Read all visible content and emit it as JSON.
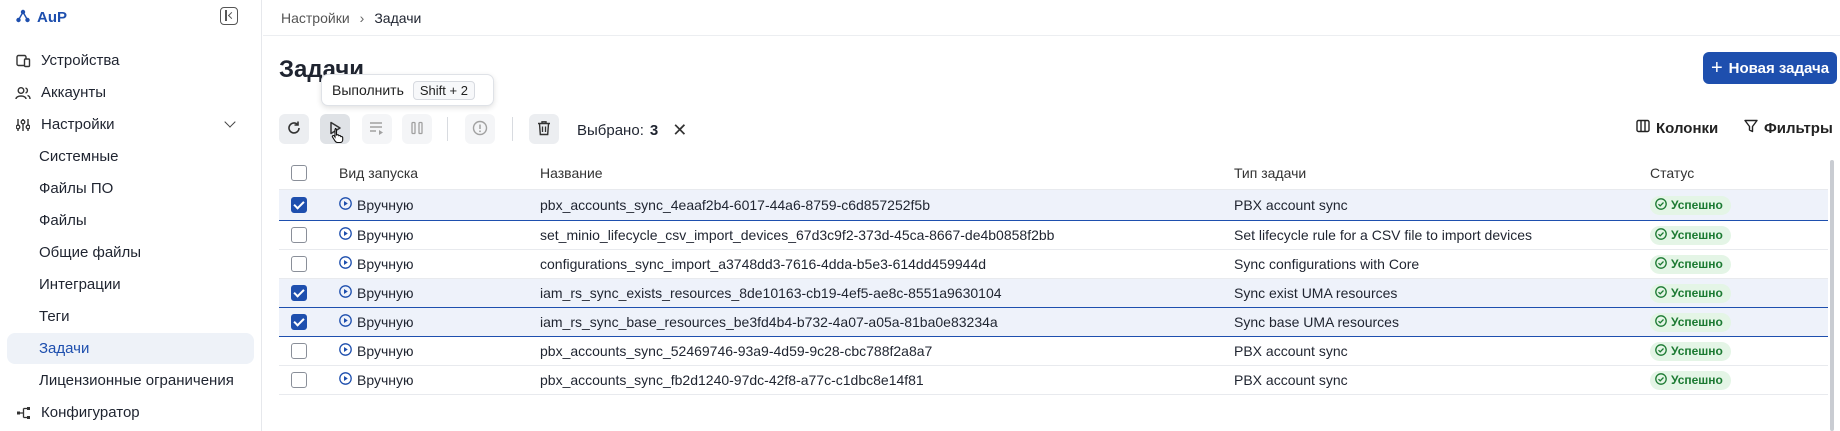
{
  "brand": {
    "name": "AuP"
  },
  "sidebar": {
    "items": [
      {
        "label": "Устройства",
        "icon": "devices-icon"
      },
      {
        "label": "Аккаунты",
        "icon": "users-icon"
      },
      {
        "label": "Настройки",
        "icon": "sliders-icon"
      },
      {
        "label": "Системные"
      },
      {
        "label": "Файлы ПО"
      },
      {
        "label": "Файлы"
      },
      {
        "label": "Общие файлы"
      },
      {
        "label": "Интеграции"
      },
      {
        "label": "Теги"
      },
      {
        "label": "Задачи",
        "active": true
      },
      {
        "label": "Лицензионные ограничения"
      },
      {
        "label": "Конфигуратор",
        "icon": "hierarchy-icon"
      }
    ]
  },
  "breadcrumb": {
    "parent": "Настройки",
    "separator": "›",
    "current": "Задачи"
  },
  "page": {
    "title": "Задачи",
    "new_button": "Новая задача"
  },
  "tooltip": {
    "label": "Выполнить",
    "shortcut": "Shift + 2"
  },
  "toolbar": {
    "selected_label": "Выбрано:",
    "selected_count": "3",
    "columns_label": "Колонки",
    "filters_label": "Фильтры"
  },
  "table": {
    "headers": {
      "mode": "Вид запуска",
      "name": "Название",
      "type": "Тип задачи",
      "status": "Статус"
    },
    "rows": [
      {
        "checked": true,
        "mode": "Вручную",
        "name": "pbx_accounts_sync_4eaaf2b4-6017-44a6-8759-c6d857252f5b",
        "type": "PBX account sync",
        "status": "Успешно"
      },
      {
        "checked": false,
        "mode": "Вручную",
        "name": "set_minio_lifecycle_csv_import_devices_67d3c9f2-373d-45ca-8667-de4b0858f2bb",
        "type": "Set lifecycle rule for a CSV file to import devices",
        "status": "Успешно"
      },
      {
        "checked": false,
        "mode": "Вручную",
        "name": "configurations_sync_import_a3748dd3-7616-4dda-b5e3-614dd459944d",
        "type": "Sync configurations with Core",
        "status": "Успешно"
      },
      {
        "checked": true,
        "mode": "Вручную",
        "name": "iam_rs_sync_exists_resources_8de10163-cb19-4ef5-ae8c-8551a9630104",
        "type": "Sync exist UMA resources",
        "status": "Успешно"
      },
      {
        "checked": true,
        "mode": "Вручную",
        "name": "iam_rs_sync_base_resources_be3fd4b4-b732-4a07-a05a-81ba0e83234a",
        "type": "Sync base UMA resources",
        "status": "Успешно"
      },
      {
        "checked": false,
        "mode": "Вручную",
        "name": "pbx_accounts_sync_52469746-93a9-4d59-9c28-cbc788f2a8a7",
        "type": "PBX account sync",
        "status": "Успешно"
      },
      {
        "checked": false,
        "mode": "Вручную",
        "name": "pbx_accounts_sync_fb2d1240-97dc-42f8-a77c-c1dbc8e14f81",
        "type": "PBX account sync",
        "status": "Успешно"
      }
    ]
  },
  "colors": {
    "accent": "#1e4fae",
    "success_bg": "#e4f5e6",
    "success_fg": "#1c7a32",
    "selected_row": "#eef2fa"
  }
}
